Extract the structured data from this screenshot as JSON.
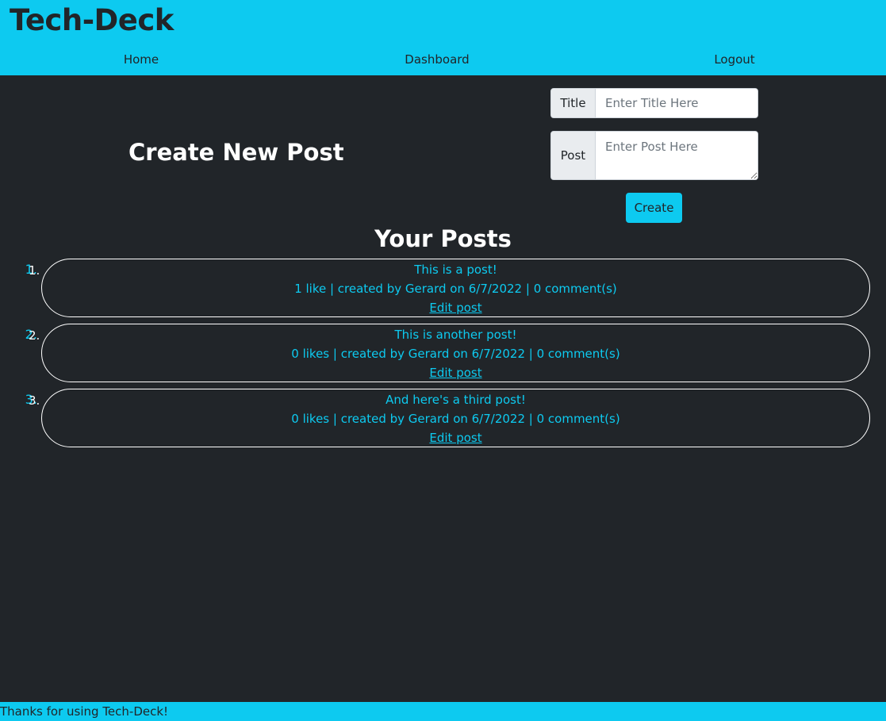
{
  "header": {
    "brand": "Tech-Deck",
    "nav": {
      "home": "Home",
      "dashboard": "Dashboard",
      "logout": "Logout"
    }
  },
  "create_form": {
    "heading": "Create New Post",
    "title_label": "Title",
    "title_placeholder": "Enter Title Here",
    "title_value": "",
    "post_label": "Post",
    "post_placeholder": "Enter Post Here",
    "post_value": "",
    "submit_label": "Create"
  },
  "posts_section": {
    "heading": "Your Posts",
    "posts": [
      {
        "number": "1.",
        "title": "This is a post!",
        "meta": "1 like | created by Gerard on 6/7/2022 | 0 comment(s)",
        "edit_label": "Edit post"
      },
      {
        "number": "2.",
        "title": "This is another post!",
        "meta": "0 likes | created by Gerard on 6/7/2022 | 0 comment(s)",
        "edit_label": "Edit post"
      },
      {
        "number": "3.",
        "title": "And here's a third post!",
        "meta": "0 likes | created by Gerard on 6/7/2022 | 0 comment(s)",
        "edit_label": "Edit post"
      }
    ]
  },
  "footer": {
    "text": "Thanks for using Tech-Deck!"
  },
  "colors": {
    "accent": "#0dcaf0",
    "background": "#212529",
    "text_dark": "#212529"
  }
}
